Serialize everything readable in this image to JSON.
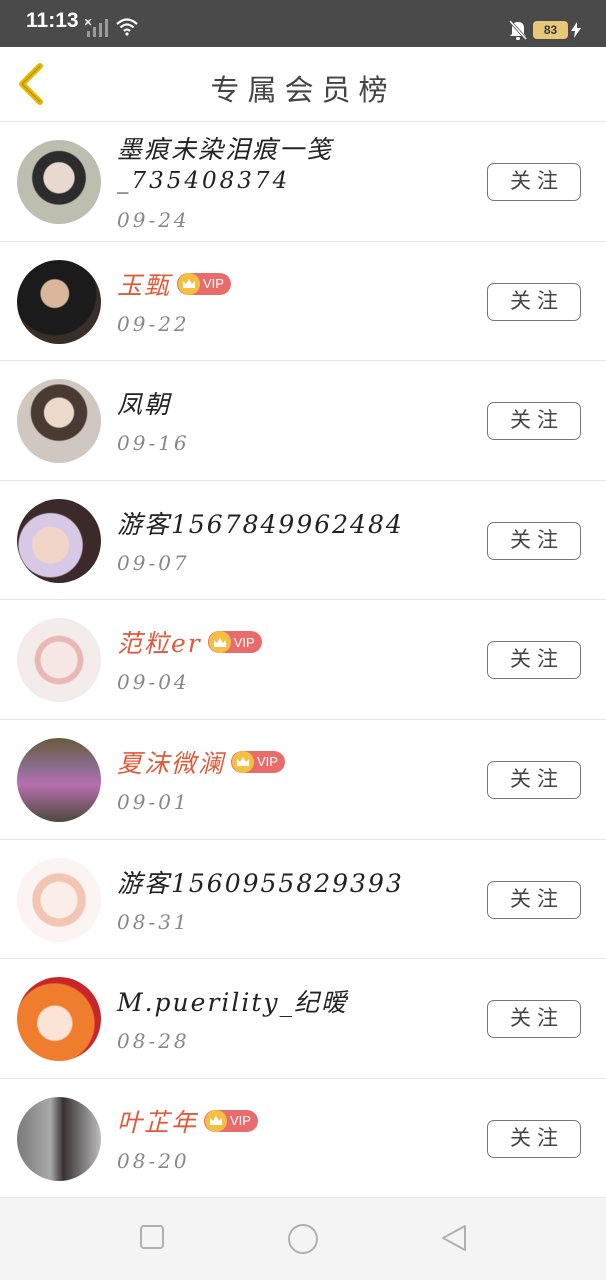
{
  "status_bar": {
    "time": "11:13",
    "battery": "83",
    "icons": [
      "signal-icon",
      "wifi-icon",
      "mute-bell-icon",
      "battery-icon",
      "charging-bolt-icon"
    ]
  },
  "header": {
    "title": "专属会员榜",
    "back_icon": "chevron-left-icon",
    "back_color": "#e8b800"
  },
  "vip_label": "VIP",
  "follow_label": "关注",
  "colors": {
    "vip_name": "#e05a3a",
    "vip_badge": "#e86c6c",
    "crown": "#f5c042"
  },
  "members": [
    {
      "name": "墨痕未染泪痕一笺",
      "name_line2": "_735408374",
      "date": "09-24",
      "vip": false
    },
    {
      "name": "玉甄",
      "date": "09-22",
      "vip": true
    },
    {
      "name": "凤朝",
      "date": "09-16",
      "vip": false
    },
    {
      "name": "游客1567849962484",
      "date": "09-07",
      "vip": false
    },
    {
      "name": "范粒er",
      "date": "09-04",
      "vip": true
    },
    {
      "name": "夏沫微澜",
      "date": "09-01",
      "vip": true
    },
    {
      "name": "游客1560955829393",
      "date": "08-31",
      "vip": false
    },
    {
      "name": "M.puerility_纪暧",
      "date": "08-28",
      "vip": false
    },
    {
      "name": "叶芷年",
      "date": "08-20",
      "vip": true
    }
  ],
  "nav_bar": {
    "icons": [
      "recent-apps-icon",
      "home-icon",
      "back-icon"
    ]
  }
}
